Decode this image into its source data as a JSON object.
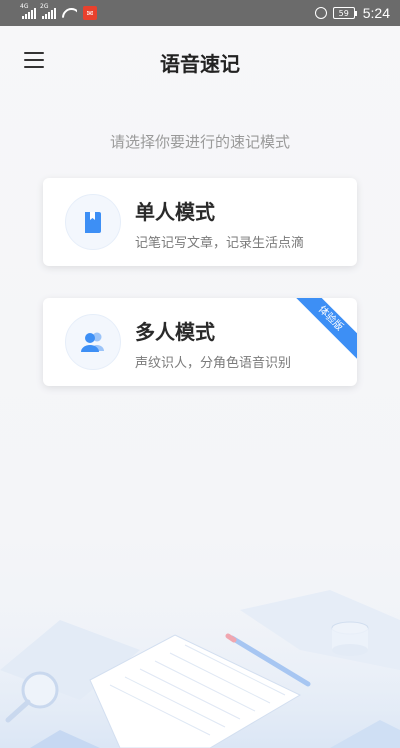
{
  "status_bar": {
    "network_1": "4G",
    "network_2": "2G",
    "battery": "59",
    "time": "5:24"
  },
  "header": {
    "title": "语音速记"
  },
  "prompt": "请选择你要进行的速记模式",
  "modes": [
    {
      "title": "单人模式",
      "description": "记笔记写文章，记录生活点滴",
      "icon": "notebook-icon"
    },
    {
      "title": "多人模式",
      "description": "声纹识人，分角色语音识别",
      "icon": "users-icon",
      "badge": "体验版"
    }
  ],
  "colors": {
    "accent": "#3d8ff5",
    "status_bar": "#6b6b6b",
    "background": "#f6f6f8"
  }
}
